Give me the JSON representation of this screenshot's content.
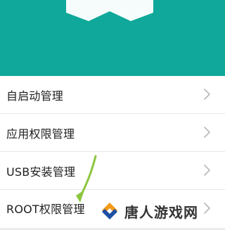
{
  "header": {
    "background_color": "#0fa89a",
    "ribbon_icon": "ribbon-icon"
  },
  "menu": {
    "items": [
      {
        "label": "自启动管理",
        "icon": "chevron-right-icon"
      },
      {
        "label": "应用权限管理",
        "icon": "chevron-right-icon"
      },
      {
        "label": "USB安装管理",
        "icon": "chevron-right-icon"
      },
      {
        "label": "ROOT权限管理",
        "icon": "chevron-right-icon"
      }
    ]
  },
  "annotation": {
    "arrow_color": "#8cc63f"
  },
  "watermark": {
    "text": "唐人游戏网",
    "logo_colors": [
      "#f39a1a",
      "#1e4fa3"
    ]
  }
}
